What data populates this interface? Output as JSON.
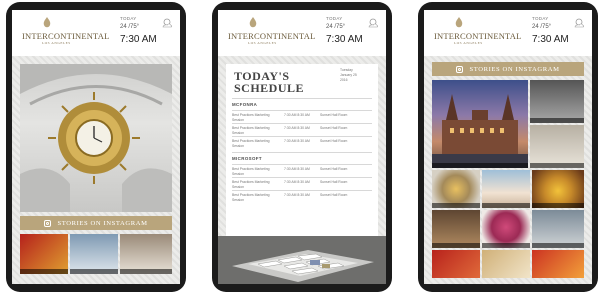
{
  "brand": {
    "logo_text": "INTERCONTINENTAL",
    "logo_sub": "LOS ANGELES"
  },
  "weather": {
    "label": "TODAY",
    "temp": "24 /75°",
    "time": "7:30 AM",
    "icon": "sun-cloud-icon"
  },
  "instagram": {
    "heading": "STORIES ON INSTAGRAM",
    "icon": "instagram-icon"
  },
  "schedule": {
    "title_line1": "TODAY'S",
    "title_line2": "SCHEDULE",
    "side_note": "Tuesday\nJanuary 25\n2016",
    "sections": [
      {
        "name": "MCFONRA",
        "rows": [
          {
            "event": "Best Practices Marketing Session",
            "time": "7:30 AM 8:30 AM",
            "room": "Sunset Hall Room"
          },
          {
            "event": "Best Practices Marketing Session",
            "time": "7:30 AM 8:30 AM",
            "room": "Sunset Hall Room"
          },
          {
            "event": "Best Practices Marketing Session",
            "time": "7:30 AM 8:30 AM",
            "room": "Sunset Hall Room"
          }
        ]
      },
      {
        "name": "MICROSOFT",
        "rows": [
          {
            "event": "Best Practices Marketing Session",
            "time": "7:30 AM 8:30 AM",
            "room": "Sunset Hall Room"
          },
          {
            "event": "Best Practices Marketing Session",
            "time": "7:30 AM 8:30 AM",
            "room": "Sunset Hall Room"
          },
          {
            "event": "Best Practices Marketing Session",
            "time": "7:30 AM 8:30 AM",
            "room": "Sunset Hall Room"
          }
        ]
      }
    ]
  },
  "colors": {
    "gold": "#b9a57c",
    "bezel": "#1b1b1b",
    "screen_bg": "#f4f4f2"
  }
}
